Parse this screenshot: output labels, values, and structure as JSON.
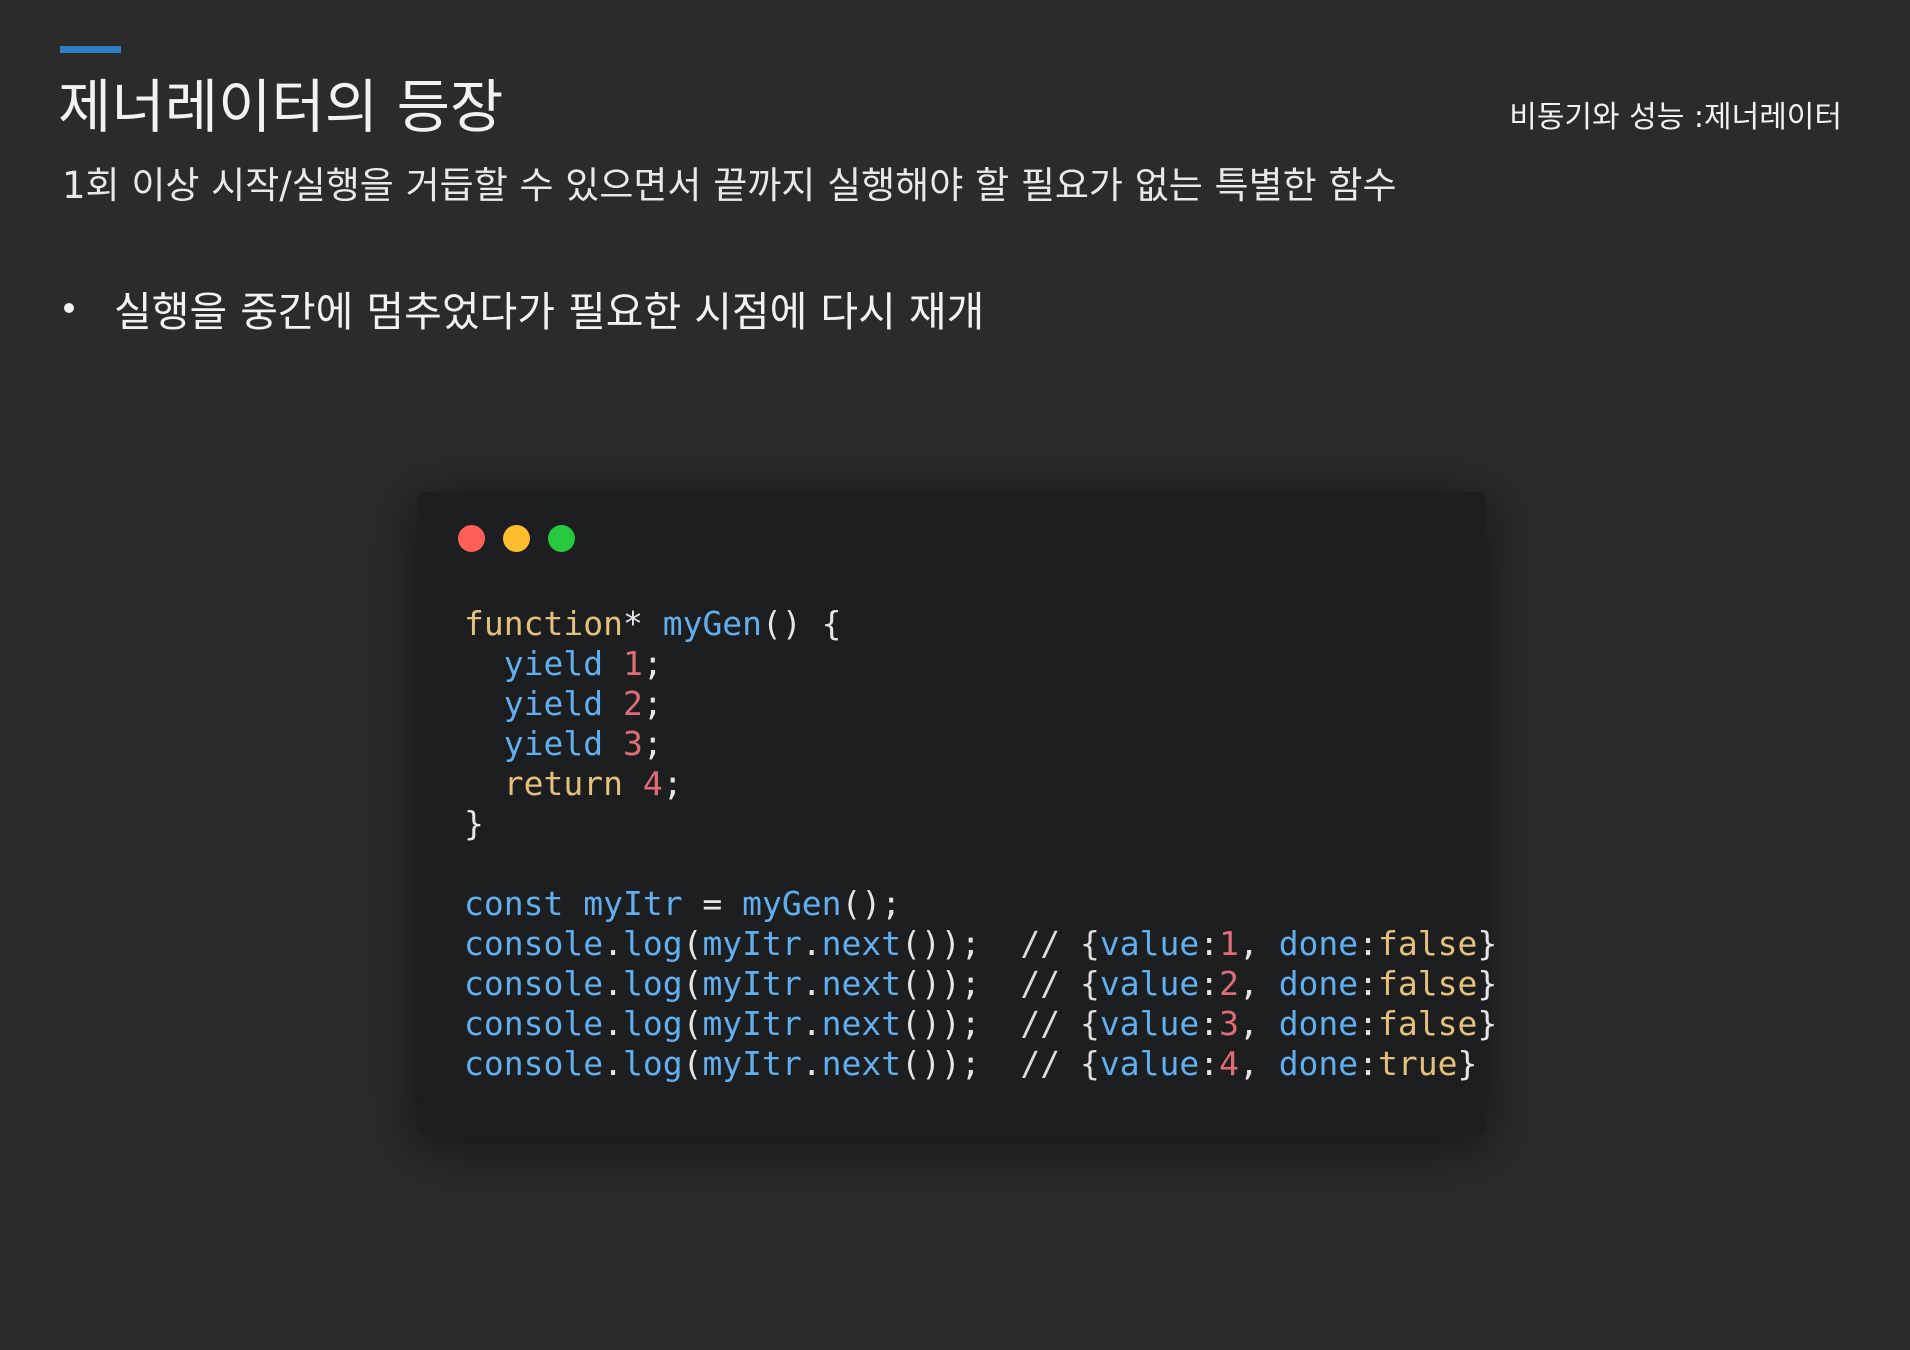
{
  "header": {
    "title": "제너레이터의 등장",
    "section_label": "비동기와 성능 :제너레이터",
    "subtitle": "1회 이상 시작/실행을 거듭할 수 있으면서 끝까지 실행해야 할 필요가 없는 특별한 함수",
    "accent_color": "#2f7dc4"
  },
  "bullets": [
    "실행을 중간에 멈추었다가 필요한 시점에 다시 재개"
  ],
  "code_window": {
    "traffic_lights": {
      "close": "#ff5f56",
      "minimize": "#ffbd2e",
      "maximize": "#27c93f"
    },
    "colors": {
      "plain": "#e6e6e6",
      "keyword": "#e5c07b",
      "identifier": "#61afef",
      "number": "#e06c75",
      "comment": "#dcdcdc"
    },
    "lines": [
      [
        {
          "t": "function",
          "c": "keyword"
        },
        {
          "t": "* ",
          "c": "plain"
        },
        {
          "t": "myGen",
          "c": "identifier"
        },
        {
          "t": "() {",
          "c": "plain"
        }
      ],
      [
        {
          "t": "  ",
          "c": "plain"
        },
        {
          "t": "yield",
          "c": "identifier"
        },
        {
          "t": " ",
          "c": "plain"
        },
        {
          "t": "1",
          "c": "number"
        },
        {
          "t": ";",
          "c": "plain"
        }
      ],
      [
        {
          "t": "  ",
          "c": "plain"
        },
        {
          "t": "yield",
          "c": "identifier"
        },
        {
          "t": " ",
          "c": "plain"
        },
        {
          "t": "2",
          "c": "number"
        },
        {
          "t": ";",
          "c": "plain"
        }
      ],
      [
        {
          "t": "  ",
          "c": "plain"
        },
        {
          "t": "yield",
          "c": "identifier"
        },
        {
          "t": " ",
          "c": "plain"
        },
        {
          "t": "3",
          "c": "number"
        },
        {
          "t": ";",
          "c": "plain"
        }
      ],
      [
        {
          "t": "  ",
          "c": "plain"
        },
        {
          "t": "return",
          "c": "keyword"
        },
        {
          "t": " ",
          "c": "plain"
        },
        {
          "t": "4",
          "c": "number"
        },
        {
          "t": ";",
          "c": "plain"
        }
      ],
      [
        {
          "t": "}",
          "c": "plain"
        }
      ],
      [],
      [
        {
          "t": "const",
          "c": "identifier"
        },
        {
          "t": " ",
          "c": "plain"
        },
        {
          "t": "myItr",
          "c": "identifier"
        },
        {
          "t": " = ",
          "c": "plain"
        },
        {
          "t": "myGen",
          "c": "identifier"
        },
        {
          "t": "();",
          "c": "plain"
        }
      ],
      [
        {
          "t": "console",
          "c": "identifier"
        },
        {
          "t": ".",
          "c": "plain"
        },
        {
          "t": "log",
          "c": "identifier"
        },
        {
          "t": "(",
          "c": "plain"
        },
        {
          "t": "myItr",
          "c": "identifier"
        },
        {
          "t": ".",
          "c": "plain"
        },
        {
          "t": "next",
          "c": "identifier"
        },
        {
          "t": "());  ",
          "c": "plain"
        },
        {
          "t": "// {",
          "c": "comment"
        },
        {
          "t": "value",
          "c": "identifier"
        },
        {
          "t": ":",
          "c": "plain"
        },
        {
          "t": "1",
          "c": "number"
        },
        {
          "t": ", ",
          "c": "plain"
        },
        {
          "t": "done",
          "c": "identifier"
        },
        {
          "t": ":",
          "c": "plain"
        },
        {
          "t": "false",
          "c": "keyword"
        },
        {
          "t": "}",
          "c": "plain"
        }
      ],
      [
        {
          "t": "console",
          "c": "identifier"
        },
        {
          "t": ".",
          "c": "plain"
        },
        {
          "t": "log",
          "c": "identifier"
        },
        {
          "t": "(",
          "c": "plain"
        },
        {
          "t": "myItr",
          "c": "identifier"
        },
        {
          "t": ".",
          "c": "plain"
        },
        {
          "t": "next",
          "c": "identifier"
        },
        {
          "t": "());  ",
          "c": "plain"
        },
        {
          "t": "// {",
          "c": "comment"
        },
        {
          "t": "value",
          "c": "identifier"
        },
        {
          "t": ":",
          "c": "plain"
        },
        {
          "t": "2",
          "c": "number"
        },
        {
          "t": ", ",
          "c": "plain"
        },
        {
          "t": "done",
          "c": "identifier"
        },
        {
          "t": ":",
          "c": "plain"
        },
        {
          "t": "false",
          "c": "keyword"
        },
        {
          "t": "}",
          "c": "plain"
        }
      ],
      [
        {
          "t": "console",
          "c": "identifier"
        },
        {
          "t": ".",
          "c": "plain"
        },
        {
          "t": "log",
          "c": "identifier"
        },
        {
          "t": "(",
          "c": "plain"
        },
        {
          "t": "myItr",
          "c": "identifier"
        },
        {
          "t": ".",
          "c": "plain"
        },
        {
          "t": "next",
          "c": "identifier"
        },
        {
          "t": "());  ",
          "c": "plain"
        },
        {
          "t": "// {",
          "c": "comment"
        },
        {
          "t": "value",
          "c": "identifier"
        },
        {
          "t": ":",
          "c": "plain"
        },
        {
          "t": "3",
          "c": "number"
        },
        {
          "t": ", ",
          "c": "plain"
        },
        {
          "t": "done",
          "c": "identifier"
        },
        {
          "t": ":",
          "c": "plain"
        },
        {
          "t": "false",
          "c": "keyword"
        },
        {
          "t": "}",
          "c": "plain"
        }
      ],
      [
        {
          "t": "console",
          "c": "identifier"
        },
        {
          "t": ".",
          "c": "plain"
        },
        {
          "t": "log",
          "c": "identifier"
        },
        {
          "t": "(",
          "c": "plain"
        },
        {
          "t": "myItr",
          "c": "identifier"
        },
        {
          "t": ".",
          "c": "plain"
        },
        {
          "t": "next",
          "c": "identifier"
        },
        {
          "t": "());  ",
          "c": "plain"
        },
        {
          "t": "// {",
          "c": "comment"
        },
        {
          "t": "value",
          "c": "identifier"
        },
        {
          "t": ":",
          "c": "plain"
        },
        {
          "t": "4",
          "c": "number"
        },
        {
          "t": ", ",
          "c": "plain"
        },
        {
          "t": "done",
          "c": "identifier"
        },
        {
          "t": ":",
          "c": "plain"
        },
        {
          "t": "true",
          "c": "keyword"
        },
        {
          "t": "}",
          "c": "plain"
        }
      ]
    ]
  }
}
